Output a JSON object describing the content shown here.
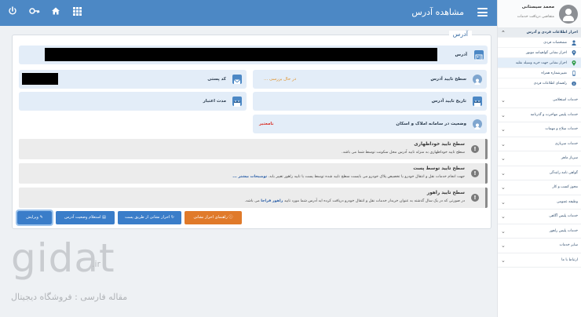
{
  "topbar": {
    "title": "مشاهده آدرس",
    "icons": [
      "power-icon",
      "key-icon",
      "home-icon",
      "grid-icon",
      "menu-icon"
    ]
  },
  "sidebar": {
    "user_name": "محمد سیستانی",
    "user_role": "متقاضی دریافت خدمات",
    "open_group": "احراز اطلاعات فردی و آدرس",
    "sub_items": [
      {
        "label": "مشخصات فردی",
        "icon": "user-icon"
      },
      {
        "label": "احراز نشانی گواهینامه موتور",
        "icon": "location-icon"
      },
      {
        "label": "احراز نشانی جهت خرید وسیله نقلیه",
        "icon": "location-icon"
      },
      {
        "label": "تغییرشماره همراه",
        "icon": "phone-icon"
      },
      {
        "label": "راهنمای اطلاعات فردی",
        "icon": "info-icon"
      }
    ],
    "items": [
      "خدمات استعلامی",
      "خدمات پلیس مهاجرت و گذرنامه",
      "خدمات سلاح و مهمات",
      "خدمات سربازی",
      "سرباز ماهر",
      "گواهی نامه رانندگی",
      "مجوز کسب و کار",
      "وظیفه عمومی",
      "خدمات پلیس آگاهی",
      "خدمات پلیس راهور",
      "سایر خدمات",
      "ارتباط با ما"
    ]
  },
  "panel": {
    "legend": "آدرس",
    "address_label": "آدرس",
    "postal_code_label": "کد پستی",
    "validity_label": "مدت اعتبار",
    "level_label": "سطح تایید آدرس",
    "level_value": "در حال بررسی ...",
    "date_label": "تاریخ تایید آدرس",
    "status_label": "وضعیت در سامانه املاک و اسکان",
    "status_value": "نامعتبر"
  },
  "alerts": [
    {
      "title": "سطح تایید خوداظهاری",
      "text": "سطح تایید خوداظهاری به منزله تایید آدرس محل سکونت توسط شما می باشد.",
      "link": ""
    },
    {
      "title": "سطح تایید توسط پست",
      "text": "جهت انجام خدمات نقل و انتقال خودرو یا تخصیص پلاک خودرو می بایست سطح تایید شده توسط پست یا تایید راهور تغییر یابد.",
      "link": "توضیحات بیشتر ..."
    },
    {
      "title": "سطح تایید راهور",
      "text": "در صورتی که در یک سال گذشته به عنوان خریدار خدمات نقل و انتقال خودرو دریافت کرده اید آدرس شما مورد تایید",
      "link": "راهور فراجا",
      "tail": " می باشد."
    }
  ],
  "buttons": {
    "edit": "ویرایش",
    "inquiry": "استعلام وضعیت آدرس",
    "post_verify": "احراز نشانی از طریق پست",
    "guide": "راهنمای احراز نشانی"
  },
  "watermark": {
    "logo": "gidat",
    "tld": ".ir",
    "tagline": "مقاله فارسی : فروشگاه دیجیتال"
  },
  "colors": {
    "topbar": "#4c88c5",
    "field_bg": "#e3edf8",
    "status_invalid": "#d9342b",
    "status_pending": "#e0922a",
    "button_blue": "#3a7dc9",
    "button_orange": "#e07a2a"
  }
}
